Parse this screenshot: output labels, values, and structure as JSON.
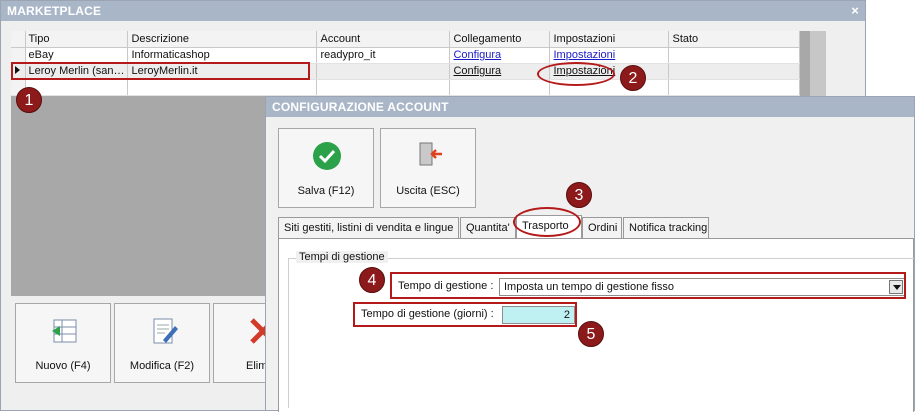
{
  "marketplace": {
    "title": "MARKETPLACE",
    "close": "×",
    "columns": [
      "Tipo",
      "Descrizione",
      "Account",
      "Collegamento",
      "Impostazioni",
      "Stato"
    ],
    "rows": [
      [
        "eBay",
        "Informaticashop",
        "readypro_it",
        "Configura",
        "Impostazioni",
        ""
      ],
      [
        "Leroy Merlin (san…",
        "LeroyMerlin.it",
        "",
        "Configura",
        "Impostazioni",
        ""
      ]
    ],
    "buttons": {
      "new": "Nuovo (F4)",
      "edit": "Modifica (F2)",
      "delete": "Elimi"
    }
  },
  "config": {
    "title": "CONFIGURAZIONE ACCOUNT",
    "save": "Salva (F12)",
    "exit": "Uscita (ESC)",
    "tabs": [
      "Siti gestiti, listini di vendita e lingue",
      "Quantita'",
      "Trasporto",
      "Ordini",
      "Notifica tracking"
    ],
    "group_title": "Tempi di gestione",
    "mode_label": "Tempo di gestione :",
    "mode_value": "Imposta un tempo di gestione fisso",
    "days_label": "Tempo di gestione (giorni) :",
    "days_value": "2"
  },
  "badges": [
    "1",
    "2",
    "3",
    "4",
    "5"
  ],
  "colors": {
    "accent": "#b41a1a",
    "badge": "#8c1a1a",
    "title": "#a9b6c8",
    "field": "#bff1f2",
    "ok": "#2ba14a",
    "exit": "#e0401e"
  }
}
